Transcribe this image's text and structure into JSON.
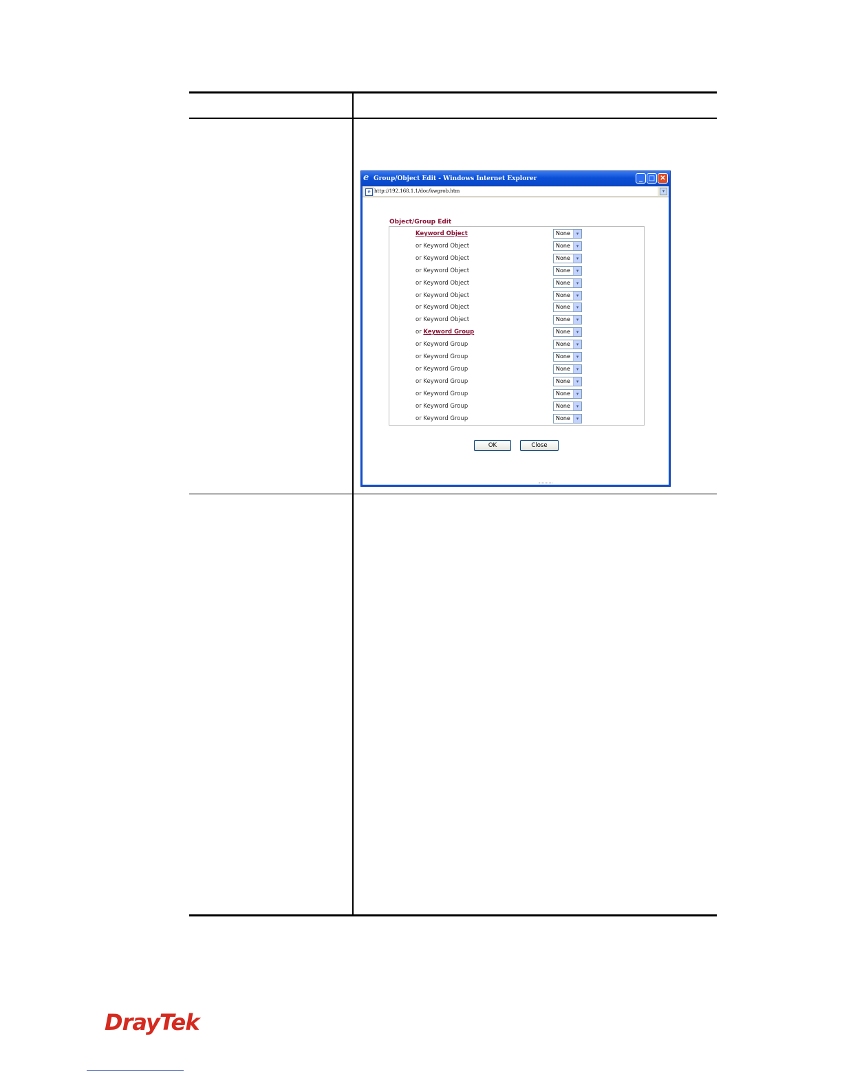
{
  "window": {
    "title": "Group/Object Edit - Windows Internet Explorer",
    "url": "http://192.168.1.1/doc/kwgrob.htm",
    "logo_glyph": "e",
    "minimize_glyph": "_",
    "maximize_glyph": "□",
    "close_glyph": "✕",
    "drop_glyph": "▾",
    "page_icon_glyph": "e"
  },
  "dialog": {
    "title": "Object/Group Edit",
    "rows": [
      {
        "prefix": "",
        "text": "Keyword Object",
        "link": true,
        "value": "None"
      },
      {
        "prefix": "or ",
        "text": "Keyword Object",
        "link": false,
        "value": "None"
      },
      {
        "prefix": "or ",
        "text": "Keyword Object",
        "link": false,
        "value": "None"
      },
      {
        "prefix": "or ",
        "text": "Keyword Object",
        "link": false,
        "value": "None"
      },
      {
        "prefix": "or ",
        "text": "Keyword Object",
        "link": false,
        "value": "None"
      },
      {
        "prefix": "or ",
        "text": "Keyword Object",
        "link": false,
        "value": "None"
      },
      {
        "prefix": "or ",
        "text": "Keyword Object",
        "link": false,
        "value": "None"
      },
      {
        "prefix": "or ",
        "text": "Keyword Object",
        "link": false,
        "value": "None"
      },
      {
        "prefix": "or ",
        "text": "Keyword Group",
        "link": true,
        "value": "None"
      },
      {
        "prefix": "or ",
        "text": "Keyword Group",
        "link": false,
        "value": "None"
      },
      {
        "prefix": "or ",
        "text": "Keyword Group",
        "link": false,
        "value": "None"
      },
      {
        "prefix": "or ",
        "text": "Keyword Group",
        "link": false,
        "value": "None"
      },
      {
        "prefix": "or ",
        "text": "Keyword Group",
        "link": false,
        "value": "None"
      },
      {
        "prefix": "or ",
        "text": "Keyword Group",
        "link": false,
        "value": "None"
      },
      {
        "prefix": "or ",
        "text": "Keyword Group",
        "link": false,
        "value": "None"
      },
      {
        "prefix": "or ",
        "text": "Keyword Group",
        "link": false,
        "value": "None"
      }
    ],
    "select_arrow": "▾",
    "ok_label": "OK",
    "close_label": "Close"
  },
  "brand": {
    "logo_text": "DrayTek",
    "logo_color": "#d42a1f"
  }
}
